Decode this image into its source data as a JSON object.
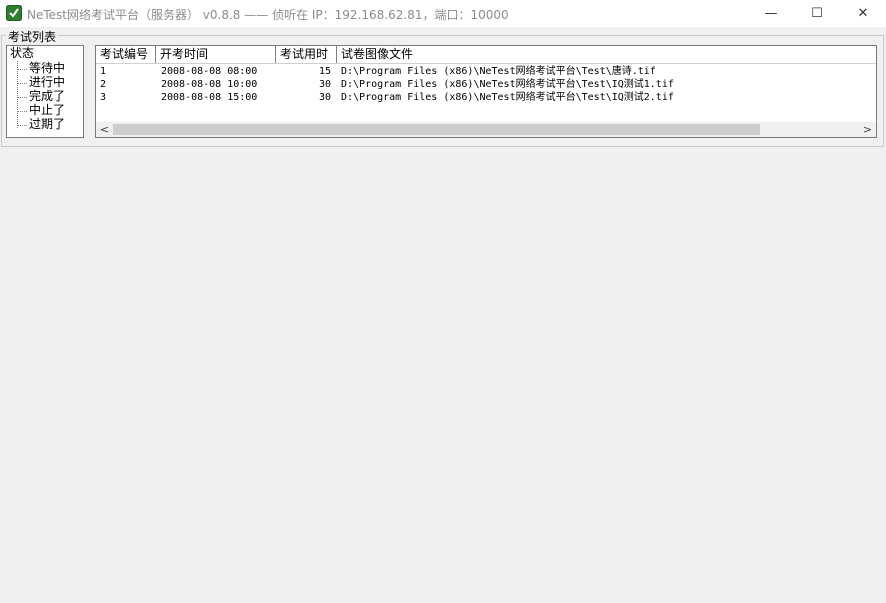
{
  "window": {
    "title": "NeTest网络考试平台（服务器） v0.8.8 —— 侦听在 IP：192.168.62.81，端口：10000",
    "app_icon": "netest-app-icon",
    "controls": {
      "minimize": "—",
      "maximize": "☐",
      "close": "✕"
    }
  },
  "exam_group": {
    "caption": "考试列表"
  },
  "status_tree": {
    "root": "状态",
    "items": [
      {
        "label": "等待中"
      },
      {
        "label": "进行中"
      },
      {
        "label": "完成了"
      },
      {
        "label": "中止了"
      },
      {
        "label": "过期了"
      }
    ]
  },
  "exam_table": {
    "columns": [
      "考试编号",
      "开考时间",
      "考试用时",
      "试卷图像文件"
    ],
    "rows": [
      {
        "id": "1",
        "start": "2008-08-08 08:00",
        "duration": "15",
        "file": "D:\\Program Files (x86)\\NeTest网络考试平台\\Test\\唐诗.tif"
      },
      {
        "id": "2",
        "start": "2008-08-08 10:00",
        "duration": "30",
        "file": "D:\\Program Files (x86)\\NeTest网络考试平台\\Test\\IQ测试1.tif"
      },
      {
        "id": "3",
        "start": "2008-08-08 15:00",
        "duration": "30",
        "file": "D:\\Program Files (x86)\\NeTest网络考试平台\\Test\\IQ测试2.tif"
      }
    ],
    "scrollbar": {
      "left_arrow": "<",
      "right_arrow": ">"
    }
  }
}
